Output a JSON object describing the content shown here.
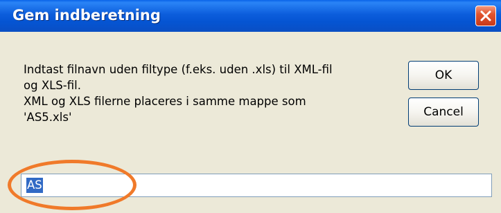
{
  "dialog": {
    "title": "Gem indberetning",
    "message_lines": [
      "Indtast filnavn uden filtype (f.eks. uden .xls) til XML-fil",
      "og XLS-fil.",
      "XML og XLS filerne placeres i samme mappe som",
      "'AS5.xls'"
    ],
    "ok_label": "OK",
    "cancel_label": "Cancel",
    "input_value": "AS",
    "close_icon": "close-icon"
  },
  "colors": {
    "titlebar": "#0554d2",
    "close_button": "#e2552f",
    "annotation_ring": "#f07a2a",
    "selection": "#316ac5"
  }
}
